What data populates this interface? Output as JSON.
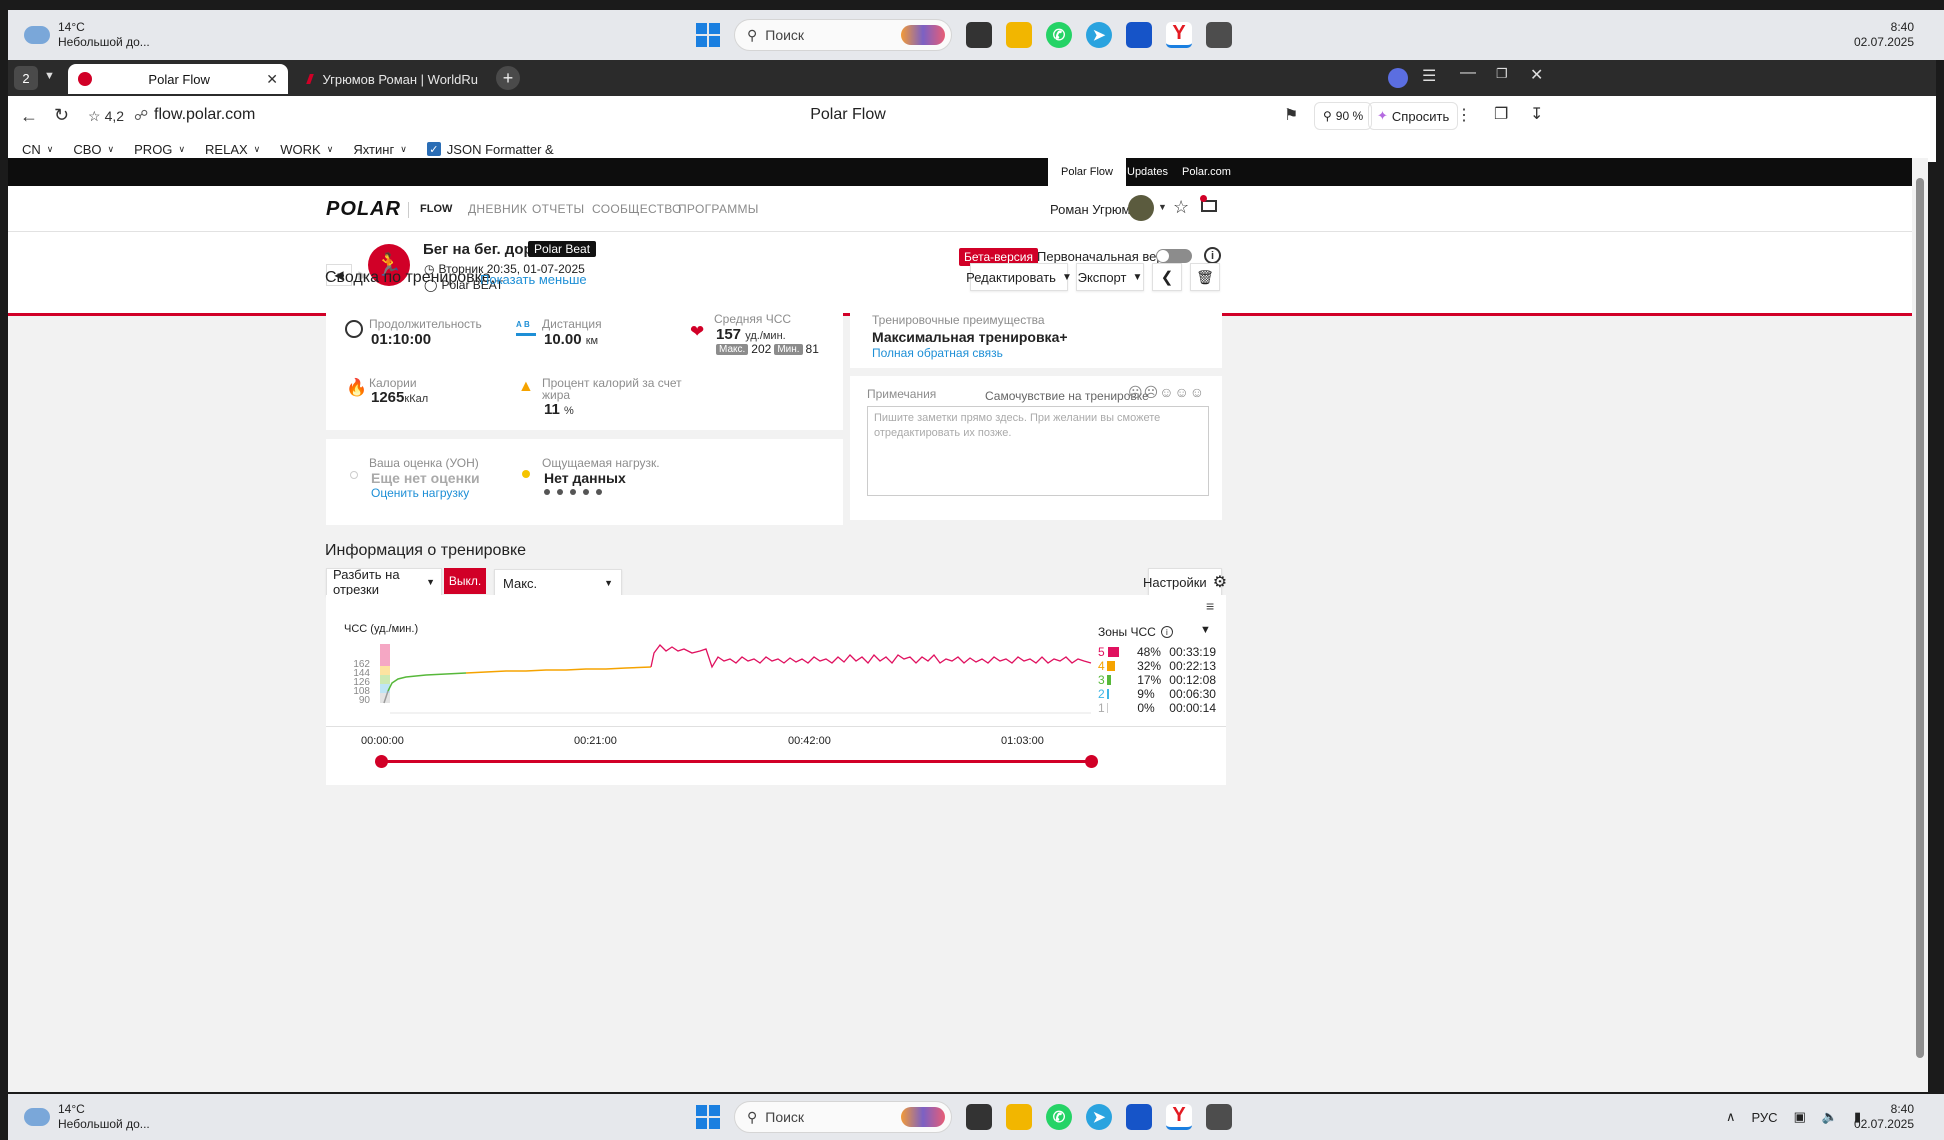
{
  "taskbar": {
    "weather_temp": "14°C",
    "weather_desc": "Небольшой до...",
    "search_placeholder": "Поиск",
    "time": "8:40",
    "date": "02.07.2025",
    "lang": "РУС"
  },
  "browser": {
    "tab_count": "2",
    "tabs": [
      {
        "title": "Polar Flow"
      },
      {
        "title": "Угрюмов Роман | WorldRu"
      }
    ],
    "rating": "4,2",
    "url": "flow.polar.com",
    "page_title": "Polar Flow",
    "zoom": "90 %",
    "ask_label": "Спросить",
    "bookmarks": [
      "CN",
      "CBO",
      "PROG",
      "RELAX",
      "WORK",
      "Яхтинг",
      "JSON Formatter &"
    ]
  },
  "site": {
    "toplinks": [
      "Polar Flow",
      "Updates",
      "Polar.com"
    ],
    "logo_text": "POLAR",
    "logo_sub": "FLOW",
    "nav": [
      "ДНЕВНИК",
      "ОТЧЕТЫ",
      "СООБЩЕСТВО",
      "ПРОГРАММЫ"
    ],
    "user_name": "Роман Угрюмов"
  },
  "session": {
    "title": "Бег на бег. дор.",
    "badge": "Polar Beat",
    "datetime": "Вторник 20:35, 01-07-2025",
    "device": "Polar BEAT",
    "beta_label": "Бета-версия",
    "original_label": "Первоначальная версия"
  },
  "summary": {
    "heading": "Сводка по тренировке",
    "show_less": "Показать меньше",
    "edit_label": "Редактировать",
    "export_label": "Экспорт",
    "duration_label": "Продолжительность",
    "duration_value": "01:10:00",
    "distance_label": "Дистанция",
    "distance_value": "10.00",
    "distance_unit": "км",
    "hr_label": "Средняя ЧСС",
    "hr_value": "157",
    "hr_unit": "уд./мин.",
    "hr_max_label": "Макс.",
    "hr_max": "202",
    "hr_min_label": "Мин.",
    "hr_min": "81",
    "calories_label": "Калории",
    "calories_value": "1265",
    "calories_unit": "кКал",
    "fat_label_1": "Процент калорий за счет",
    "fat_label_2": "жира",
    "fat_value": "11",
    "fat_unit": "%",
    "rpe_label": "Ваша оценка (УОН)",
    "rpe_value": "Еще нет оценки",
    "rpe_link": "Оценить нагрузку",
    "load_label": "Ощущаемая нагрузк.",
    "load_value": "Нет данных",
    "benefit_label": "Тренировочные преимущества",
    "benefit_value": "Максимальная тренировка+",
    "benefit_link": "Полная обратная связь",
    "notes_label": "Примечания",
    "feeling_label": "Самочувствие на тренировке",
    "notes_placeholder": "Пишите заметки прямо здесь. При желании вы сможете отредактировать их позже."
  },
  "info": {
    "heading": "Информация о тренировке",
    "split_label": "Разбить на отрезки",
    "off_label": "Выкл.",
    "max_select": "Макс.",
    "settings_label": "Настройки",
    "hr_axis_label": "ЧСС (уд./мин.)",
    "zones_label": "Зоны ЧСС",
    "yticks": [
      "162",
      "144",
      "126",
      "108",
      "90"
    ],
    "timeline": [
      "00:00:00",
      "00:21:00",
      "00:42:00",
      "01:03:00"
    ]
  },
  "zones": [
    {
      "zone": "5",
      "pct": "48%",
      "time": "00:33:19",
      "color": "#e0115f"
    },
    {
      "zone": "4",
      "pct": "32%",
      "time": "00:22:13",
      "color": "#f5a300"
    },
    {
      "zone": "3",
      "pct": "17%",
      "time": "00:12:08",
      "color": "#57b83a"
    },
    {
      "zone": "2",
      "pct": "9%",
      "time": "00:06:30",
      "color": "#3fb6e6"
    },
    {
      "zone": "1",
      "pct": "0%",
      "time": "00:00:14",
      "color": "#b0b0b0"
    }
  ],
  "colors": {
    "brand_red": "#d10027",
    "link_blue": "#1e8fd6"
  }
}
